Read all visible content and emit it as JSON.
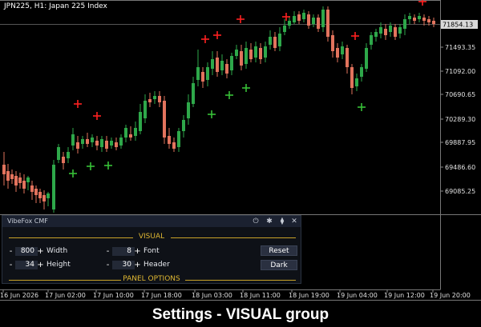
{
  "chart": {
    "symbol_label": "JPN225, H1:  Japan 225 Index",
    "price_labels": [
      "71493.35",
      "71092.00",
      "70690.65",
      "70289.30",
      "69887.95",
      "69486.60",
      "69085.25"
    ],
    "current_price": "71854.13",
    "time_labels": [
      "16 Jun 2026",
      "17 Jun 02:00",
      "17 Jun 10:00",
      "17 Jun 18:00",
      "18 Jun 03:00",
      "18 Jun 11:00",
      "18 Jun 19:00",
      "19 Jun 04:00",
      "19 Jun 12:00",
      "19 Jun 20:00"
    ],
    "colors": {
      "bull": "#2ea84a",
      "bear": "#e2735d",
      "red_marker": "#ff2020",
      "green_marker": "#38c038",
      "accent": "#c9a227"
    }
  },
  "panel": {
    "title": "VibeFox CMF",
    "icons": [
      "power-icon",
      "gear-icon",
      "pin-icon",
      "close-icon"
    ],
    "icon_glyphs": [
      "⏻",
      "✱",
      "⧫",
      "✕"
    ],
    "visual_heading": "VISUAL",
    "width_label": "Width",
    "width_value": "800",
    "height_label": "Height",
    "height_value": "34",
    "font_label": "Font",
    "font_value": "8",
    "header_label": "Header",
    "header_value": "30",
    "minus": "-",
    "plus": "+",
    "reset_label": "Reset",
    "dark_label": "Dark",
    "panel_options_heading": "PANEL OPTIONS"
  },
  "caption": "Settings - VISUAL group"
}
